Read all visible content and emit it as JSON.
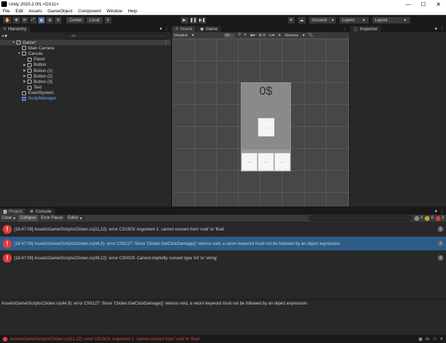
{
  "window": {
    "title": "Unity 2020.2.0f1 <DX11>",
    "controls": [
      "—",
      "☐",
      "✕"
    ]
  },
  "menu": [
    "File",
    "Edit",
    "Assets",
    "GameObject",
    "Component",
    "Window",
    "Help"
  ],
  "toolbar": {
    "pivot_label": "Center",
    "space_label": "Local",
    "account_label": "Account",
    "layers_label": "Layers",
    "layout_label": "Layout"
  },
  "hierarchy": {
    "tab_label": "Hierarchy",
    "search_placeholder": "All",
    "scene_name": "Game*",
    "items": [
      {
        "label": "Main Camera",
        "depth": 1,
        "arrow": "",
        "blue": false
      },
      {
        "label": "Canvas",
        "depth": 1,
        "arrow": "▼",
        "blue": false
      },
      {
        "label": "Panel",
        "depth": 2,
        "arrow": "",
        "blue": false
      },
      {
        "label": "Button",
        "depth": 2,
        "arrow": "▶",
        "blue": false
      },
      {
        "label": "Button (1)",
        "depth": 2,
        "arrow": "▶",
        "blue": false
      },
      {
        "label": "Button (2)",
        "depth": 2,
        "arrow": "▶",
        "blue": false
      },
      {
        "label": "Button (3)",
        "depth": 2,
        "arrow": "▶",
        "blue": false
      },
      {
        "label": "Text",
        "depth": 2,
        "arrow": "",
        "blue": false
      },
      {
        "label": "EventSystem",
        "depth": 1,
        "arrow": "",
        "blue": false
      },
      {
        "label": "ScriptManager",
        "depth": 1,
        "arrow": "",
        "blue": true
      }
    ]
  },
  "scene_tabs": {
    "scene_label": "Scene",
    "game_label": "Game",
    "shading_label": "Shaded",
    "view_2d_label": "2D",
    "gizmos_label": "Gizmos"
  },
  "game": {
    "money_text": "0$",
    "click_button_text": "...",
    "bottom_buttons": [
      "...",
      "...",
      "..."
    ]
  },
  "inspector": {
    "tab_label": "Inspector"
  },
  "console": {
    "project_tab": "Project",
    "console_tab": "Console",
    "clear_label": "Clear",
    "collapse_label": "Collapse",
    "error_pause_label": "Error Pause",
    "editor_label": "Editor",
    "counts": {
      "log": "0",
      "warn": "0",
      "error": "3"
    },
    "entries": [
      {
        "text": "[18:47:09] Assets\\Game\\Scripts\\Clicker.cs(31,22): error CS1503: Argument 1: cannot convert from 'void' to 'float'",
        "count": "1"
      },
      {
        "text": "[18:47:09] Assets\\Game\\Scripts\\Clicker.cs(44,9): error CS0127: Since 'Clicker.GetClickDamage()' returns void, a return keyword must not be followed by an object expression",
        "count": "1"
      },
      {
        "text": "[18:47:09] Assets\\Game\\Scripts\\Clicker.cs(49,22): error CS0029: Cannot implicitly convert type 'int' to 'string'",
        "count": "1"
      }
    ],
    "detail_text": "Assets\\Game\\Scripts\\Clicker.cs(44,9): error CS0127: Since 'Clicker.GetClickDamage()' returns void, a return keyword must not be followed by an object expression"
  },
  "statusbar": {
    "message": "Assets\\Game\\Scripts\\Clicker.cs(31,22): error CS1503: Argument 1: cannot convert from 'void' to 'float'"
  },
  "colors": {
    "accent_selected": "#2c5d87",
    "error_red": "#e03b3b",
    "hierarchy_blue": "#6fa8ff"
  }
}
